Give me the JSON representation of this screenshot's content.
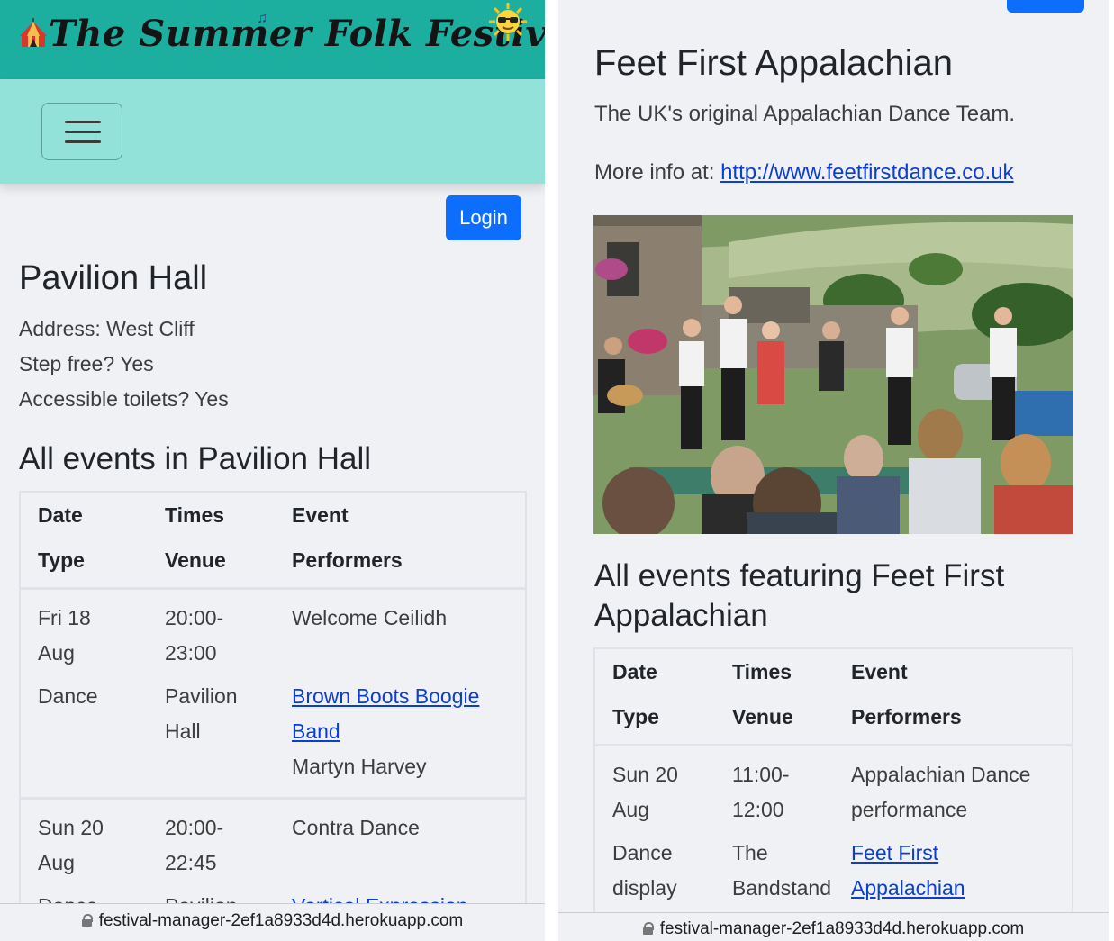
{
  "left": {
    "banner": {
      "title": "The Summer Folk Festival"
    },
    "login_label": "Login",
    "venue": {
      "name": "Pavilion Hall",
      "address": "Address: West Cliff",
      "step_free": "Step free? Yes",
      "toilets": "Accessible toilets? Yes"
    },
    "section_title": "All events in Pavilion Hall",
    "table": {
      "headers": {
        "date": "Date",
        "times": "Times",
        "event": "Event",
        "type": "Type",
        "venue": "Venue",
        "performers": "Performers"
      },
      "rows": [
        {
          "date_1": "Fri 18",
          "date_2": "Aug",
          "time_1": "20:00-",
          "time_2": "23:00",
          "event": "Welcome Ceilidh",
          "type": "Dance",
          "venue_1": "Pavilion",
          "venue_2": "Hall",
          "perf_link_1": "Brown Boots Boogie",
          "perf_link_2": "Band",
          "perf_text": "Martyn Harvey"
        },
        {
          "date_1": "Sun 20",
          "date_2": "Aug",
          "time_1": "20:00-",
          "time_2": "22:45",
          "event": "Contra Dance",
          "type": "Dance",
          "venue_1": "Pavilion",
          "perf_link_1": "Vertical Expression"
        }
      ]
    },
    "url": "festival-manager-2ef1a8933d4d.herokuapp.com"
  },
  "right": {
    "performer": {
      "name": "Feet First Appalachian",
      "description": "The UK's original Appalachian Dance Team.",
      "more_info_label": "More info at: ",
      "more_info_url": "http://www.feetfirstdance.co.uk"
    },
    "section_title_1": "All events featuring Feet First",
    "section_title_2": "Appalachian",
    "table": {
      "headers": {
        "date": "Date",
        "times": "Times",
        "event": "Event",
        "type": "Type",
        "venue": "Venue",
        "performers": "Performers"
      },
      "rows": [
        {
          "date_1": "Sun 20",
          "date_2": "Aug",
          "time_1": "11:00-",
          "time_2": "12:00",
          "event_1": "Appalachian Dance",
          "event_2": "performance",
          "type_1": "Dance",
          "type_2": "display",
          "venue_1": "The",
          "venue_2": "Bandstand",
          "perf_link_1": "Feet First",
          "perf_link_2": "Appalachian"
        }
      ]
    },
    "url": "festival-manager-2ef1a8933d4d.herokuapp.com"
  },
  "colors": {
    "banner": "#1cae9f",
    "navbar": "#92e2d9",
    "primary": "#0d6efd",
    "link": "#0b3ed1",
    "page_bg": "#f0f1f5"
  },
  "icons": [
    "circus-tent-icon",
    "music-note-icon",
    "sunglasses-sun-icon",
    "hamburger-menu-icon",
    "lock-icon"
  ]
}
